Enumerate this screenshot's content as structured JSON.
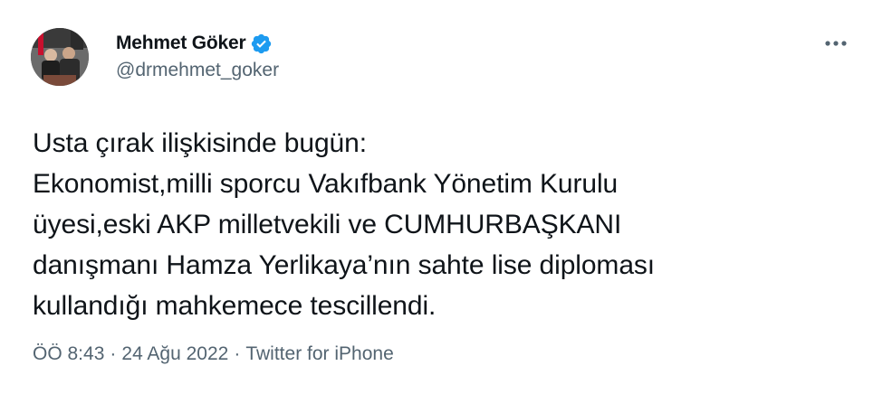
{
  "author": {
    "display_name": "Mehmet Göker",
    "handle": "@drmehmet_goker",
    "verified": true,
    "avatar_icon": "profile-photo"
  },
  "tweet": {
    "text": "Usta çırak ilişkisinde bugün:\nEkonomist,milli sporcu Vakıfbank Yönetim Kurulu\nüyesi,eski AKP milletvekili ve CUMHURBAŞKANI\ndanışmanı Hamza Yerlikaya’nın sahte lise diploması\nkullandığı mahkemece tescillendi."
  },
  "meta": {
    "time": "ÖÖ 8:43",
    "separator_1": "·",
    "date": "24 Ağu 2022",
    "separator_2": "·",
    "source": "Twitter for iPhone"
  },
  "colors": {
    "text_primary": "#0f1419",
    "text_secondary": "#536471",
    "verified_blue": "#1d9bf0"
  },
  "icons": {
    "verified": "verified-badge-icon",
    "more": "more-horizontal-icon"
  }
}
